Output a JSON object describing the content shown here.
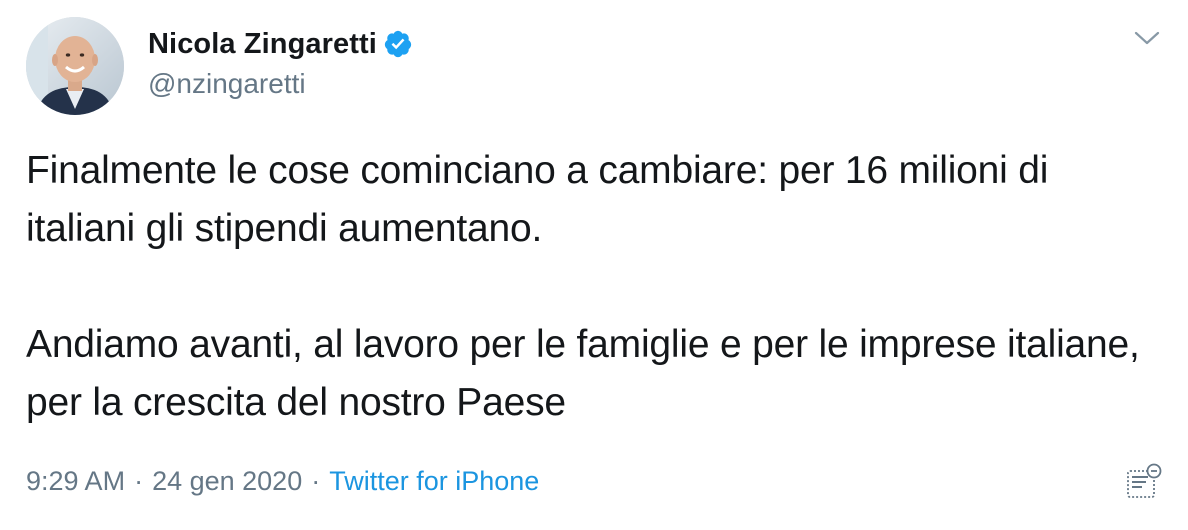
{
  "author": {
    "display_name": "Nicola Zingaretti",
    "handle": "@nzingaretti",
    "verified": true
  },
  "tweet": {
    "text": "Finalmente le cose cominciano a cambiare: per 16 milioni di italiani gli stipendi aumentano.\n\nAndiamo avanti, al lavoro per le famiglie e per le imprese italiane, per la crescita del nostro Paese"
  },
  "meta": {
    "time": "9:29 AM",
    "separator": "·",
    "date": "24 gen 2020",
    "source": "Twitter for iPhone"
  },
  "icons": {
    "verified": "verified-badge-icon",
    "caret": "chevron-down-icon",
    "analytics": "tweet-analytics-icon"
  },
  "colors": {
    "text": "#14171a",
    "secondary": "#657786",
    "link": "#1b95e0",
    "verified": "#1da1f2"
  }
}
